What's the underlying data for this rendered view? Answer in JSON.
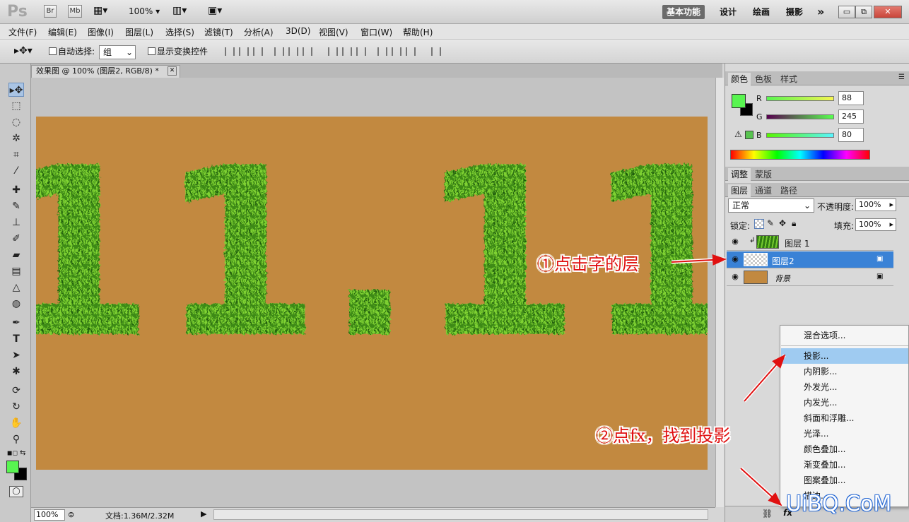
{
  "app": {
    "logo": "Ps",
    "bridge_btn": "Br",
    "minibridge_btn": "Mb",
    "zoom": "100%",
    "workspaces": [
      "基本功能",
      "设计",
      "绘画",
      "摄影"
    ],
    "more": "»",
    "window_controls": {
      "minimize": "▭",
      "restore": "⧉",
      "close": "✕"
    },
    "close_color": "#c9453a"
  },
  "menu": [
    "文件(F)",
    "编辑(E)",
    "图像(I)",
    "图层(L)",
    "选择(S)",
    "滤镜(T)",
    "分析(A)",
    "3D(D)",
    "视图(V)",
    "窗口(W)",
    "帮助(H)"
  ],
  "options": {
    "auto_select_label": "自动选择:",
    "auto_select_value": "组",
    "show_transform_label": "显示变换控件"
  },
  "document": {
    "tab_title": "效果图 @ 100% (图层2, RGB/8) *",
    "canvas_color": "#c28940",
    "artwork_text": "11.11",
    "zoom": "100%",
    "doc_size": "文档:1.36M/2.32M"
  },
  "tools": {
    "fg_color": "#58f550",
    "bg_color": "#000000"
  },
  "color_panel": {
    "tabs": [
      "颜色",
      "色板",
      "样式"
    ],
    "r_label": "R",
    "r": "88",
    "g_label": "G",
    "g": "245",
    "b_label": "B",
    "b": "80"
  },
  "adjust_panel": {
    "tabs": [
      "调整",
      "蒙版"
    ]
  },
  "layers_panel": {
    "tabs": [
      "图层",
      "通道",
      "路径"
    ],
    "blend_mode": "正常",
    "opacity_label": "不透明度:",
    "opacity": "100%",
    "lock_label": "锁定:",
    "fill_label": "填充:",
    "fill": "100%",
    "layers": [
      {
        "name": "图层 1",
        "selected": false
      },
      {
        "name": "图层2",
        "selected": true
      },
      {
        "name": "背景",
        "selected": false
      }
    ]
  },
  "context_menu": {
    "items": [
      "混合选项...",
      "投影...",
      "内阴影...",
      "外发光...",
      "内发光...",
      "斜面和浮雕...",
      "光泽...",
      "颜色叠加...",
      "渐变叠加...",
      "图案叠加...",
      "描边..."
    ],
    "highlighted": "投影...",
    "highlight_color": "#9fcbf1"
  },
  "annotations": {
    "step1": "①点击字的层",
    "step2": "②点fx，找到投影"
  },
  "watermark": "UiBQ.CoM"
}
